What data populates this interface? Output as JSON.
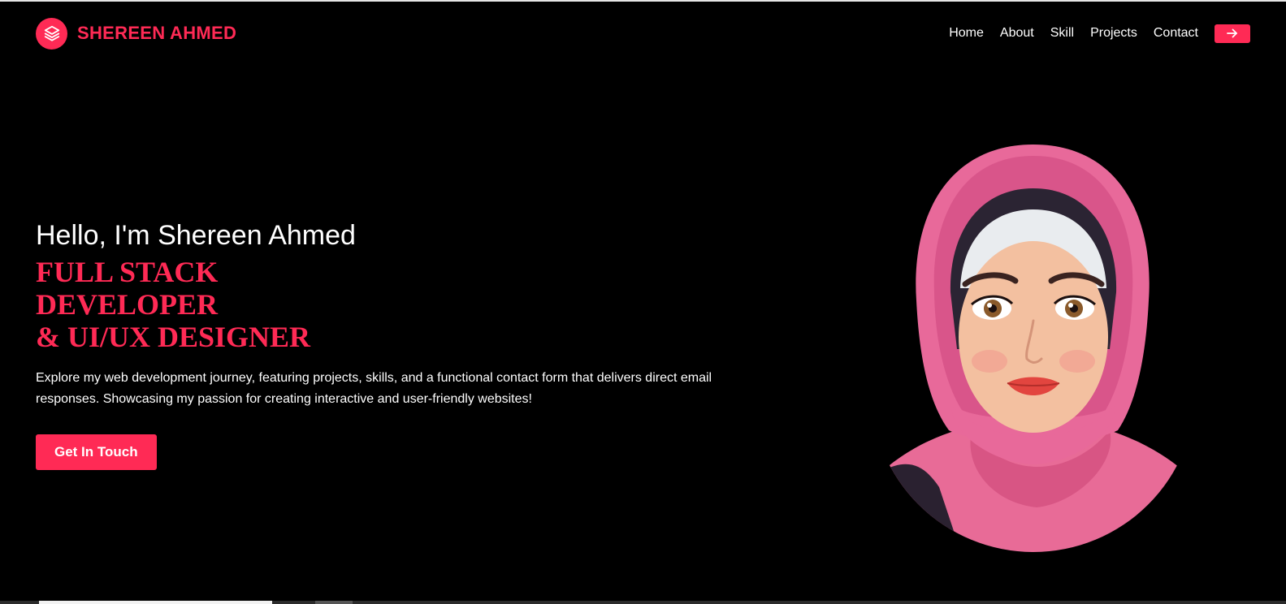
{
  "brand": {
    "name": "SHEREEN AHMED",
    "logo_icon": "layers-stack-icon"
  },
  "nav": {
    "items": [
      {
        "label": "Home"
      },
      {
        "label": "About"
      },
      {
        "label": "Skill"
      },
      {
        "label": "Projects"
      },
      {
        "label": "Contact"
      }
    ],
    "arrow_icon": "arrow-right-icon"
  },
  "hero": {
    "greeting": "Hello, I'm Shereen Ahmed",
    "title_lines": [
      "FULL STACK",
      "DEVELOPER",
      "& UI/UX DESIGNER"
    ],
    "description": "Explore my web development journey, featuring projects, skills, and a functional contact form that delivers direct email responses. Showcasing my passion for creating interactive and user-friendly websites!",
    "cta_label": "Get In Touch"
  },
  "colors": {
    "accent": "#ff2a55",
    "background": "#000000",
    "text": "#ffffff"
  }
}
